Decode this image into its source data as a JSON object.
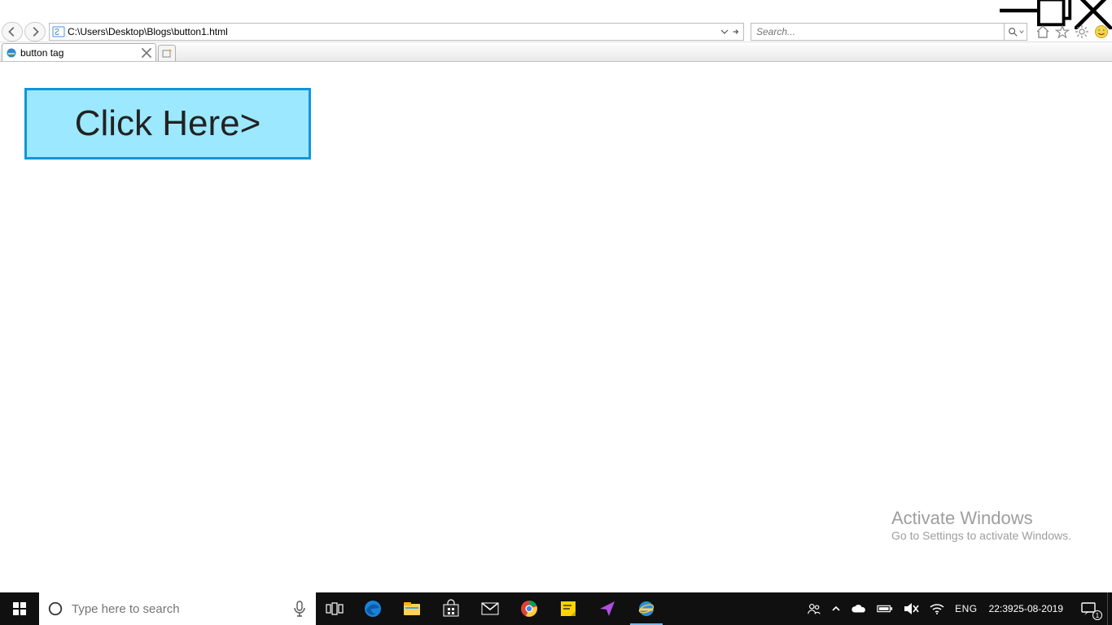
{
  "window": {
    "minimize_title": "Minimize",
    "maximize_title": "Restore",
    "close_title": "Close"
  },
  "browser": {
    "address": "C:\\Users\\Desktop\\Blogs\\button1.html",
    "search_placeholder": "Search...",
    "tab_title": "button tag"
  },
  "page": {
    "button_label": "Click Here>"
  },
  "watermark": {
    "line1": "Activate Windows",
    "line2": "Go to Settings to activate Windows."
  },
  "taskbar": {
    "search_placeholder": "Type here to search",
    "language": "ENG",
    "time": "22:39",
    "date": "25-08-2019",
    "notif_count": "1"
  }
}
